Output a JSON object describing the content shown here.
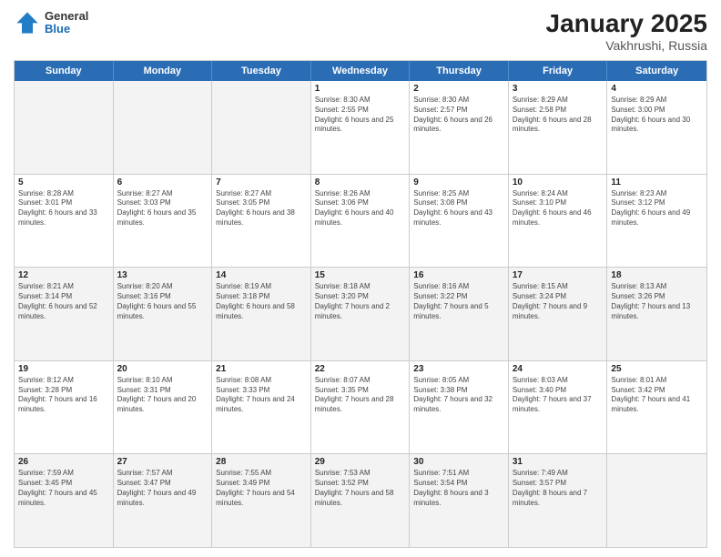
{
  "header": {
    "logo": {
      "general": "General",
      "blue": "Blue"
    },
    "title": "January 2025",
    "location": "Vakhrushi, Russia"
  },
  "weekdays": [
    "Sunday",
    "Monday",
    "Tuesday",
    "Wednesday",
    "Thursday",
    "Friday",
    "Saturday"
  ],
  "weeks": [
    [
      {
        "day": "",
        "sunrise": "",
        "sunset": "",
        "daylight": "",
        "shaded": true
      },
      {
        "day": "",
        "sunrise": "",
        "sunset": "",
        "daylight": "",
        "shaded": true
      },
      {
        "day": "",
        "sunrise": "",
        "sunset": "",
        "daylight": "",
        "shaded": true
      },
      {
        "day": "1",
        "sunrise": "Sunrise: 8:30 AM",
        "sunset": "Sunset: 2:55 PM",
        "daylight": "Daylight: 6 hours and 25 minutes."
      },
      {
        "day": "2",
        "sunrise": "Sunrise: 8:30 AM",
        "sunset": "Sunset: 2:57 PM",
        "daylight": "Daylight: 6 hours and 26 minutes."
      },
      {
        "day": "3",
        "sunrise": "Sunrise: 8:29 AM",
        "sunset": "Sunset: 2:58 PM",
        "daylight": "Daylight: 6 hours and 28 minutes."
      },
      {
        "day": "4",
        "sunrise": "Sunrise: 8:29 AM",
        "sunset": "Sunset: 3:00 PM",
        "daylight": "Daylight: 6 hours and 30 minutes."
      }
    ],
    [
      {
        "day": "5",
        "sunrise": "Sunrise: 8:28 AM",
        "sunset": "Sunset: 3:01 PM",
        "daylight": "Daylight: 6 hours and 33 minutes."
      },
      {
        "day": "6",
        "sunrise": "Sunrise: 8:27 AM",
        "sunset": "Sunset: 3:03 PM",
        "daylight": "Daylight: 6 hours and 35 minutes."
      },
      {
        "day": "7",
        "sunrise": "Sunrise: 8:27 AM",
        "sunset": "Sunset: 3:05 PM",
        "daylight": "Daylight: 6 hours and 38 minutes."
      },
      {
        "day": "8",
        "sunrise": "Sunrise: 8:26 AM",
        "sunset": "Sunset: 3:06 PM",
        "daylight": "Daylight: 6 hours and 40 minutes."
      },
      {
        "day": "9",
        "sunrise": "Sunrise: 8:25 AM",
        "sunset": "Sunset: 3:08 PM",
        "daylight": "Daylight: 6 hours and 43 minutes."
      },
      {
        "day": "10",
        "sunrise": "Sunrise: 8:24 AM",
        "sunset": "Sunset: 3:10 PM",
        "daylight": "Daylight: 6 hours and 46 minutes."
      },
      {
        "day": "11",
        "sunrise": "Sunrise: 8:23 AM",
        "sunset": "Sunset: 3:12 PM",
        "daylight": "Daylight: 6 hours and 49 minutes."
      }
    ],
    [
      {
        "day": "12",
        "sunrise": "Sunrise: 8:21 AM",
        "sunset": "Sunset: 3:14 PM",
        "daylight": "Daylight: 6 hours and 52 minutes.",
        "shaded": true
      },
      {
        "day": "13",
        "sunrise": "Sunrise: 8:20 AM",
        "sunset": "Sunset: 3:16 PM",
        "daylight": "Daylight: 6 hours and 55 minutes.",
        "shaded": true
      },
      {
        "day": "14",
        "sunrise": "Sunrise: 8:19 AM",
        "sunset": "Sunset: 3:18 PM",
        "daylight": "Daylight: 6 hours and 58 minutes.",
        "shaded": true
      },
      {
        "day": "15",
        "sunrise": "Sunrise: 8:18 AM",
        "sunset": "Sunset: 3:20 PM",
        "daylight": "Daylight: 7 hours and 2 minutes.",
        "shaded": true
      },
      {
        "day": "16",
        "sunrise": "Sunrise: 8:16 AM",
        "sunset": "Sunset: 3:22 PM",
        "daylight": "Daylight: 7 hours and 5 minutes.",
        "shaded": true
      },
      {
        "day": "17",
        "sunrise": "Sunrise: 8:15 AM",
        "sunset": "Sunset: 3:24 PM",
        "daylight": "Daylight: 7 hours and 9 minutes.",
        "shaded": true
      },
      {
        "day": "18",
        "sunrise": "Sunrise: 8:13 AM",
        "sunset": "Sunset: 3:26 PM",
        "daylight": "Daylight: 7 hours and 13 minutes.",
        "shaded": true
      }
    ],
    [
      {
        "day": "19",
        "sunrise": "Sunrise: 8:12 AM",
        "sunset": "Sunset: 3:28 PM",
        "daylight": "Daylight: 7 hours and 16 minutes."
      },
      {
        "day": "20",
        "sunrise": "Sunrise: 8:10 AM",
        "sunset": "Sunset: 3:31 PM",
        "daylight": "Daylight: 7 hours and 20 minutes."
      },
      {
        "day": "21",
        "sunrise": "Sunrise: 8:08 AM",
        "sunset": "Sunset: 3:33 PM",
        "daylight": "Daylight: 7 hours and 24 minutes."
      },
      {
        "day": "22",
        "sunrise": "Sunrise: 8:07 AM",
        "sunset": "Sunset: 3:35 PM",
        "daylight": "Daylight: 7 hours and 28 minutes."
      },
      {
        "day": "23",
        "sunrise": "Sunrise: 8:05 AM",
        "sunset": "Sunset: 3:38 PM",
        "daylight": "Daylight: 7 hours and 32 minutes."
      },
      {
        "day": "24",
        "sunrise": "Sunrise: 8:03 AM",
        "sunset": "Sunset: 3:40 PM",
        "daylight": "Daylight: 7 hours and 37 minutes."
      },
      {
        "day": "25",
        "sunrise": "Sunrise: 8:01 AM",
        "sunset": "Sunset: 3:42 PM",
        "daylight": "Daylight: 7 hours and 41 minutes."
      }
    ],
    [
      {
        "day": "26",
        "sunrise": "Sunrise: 7:59 AM",
        "sunset": "Sunset: 3:45 PM",
        "daylight": "Daylight: 7 hours and 45 minutes.",
        "shaded": true
      },
      {
        "day": "27",
        "sunrise": "Sunrise: 7:57 AM",
        "sunset": "Sunset: 3:47 PM",
        "daylight": "Daylight: 7 hours and 49 minutes.",
        "shaded": true
      },
      {
        "day": "28",
        "sunrise": "Sunrise: 7:55 AM",
        "sunset": "Sunset: 3:49 PM",
        "daylight": "Daylight: 7 hours and 54 minutes.",
        "shaded": true
      },
      {
        "day": "29",
        "sunrise": "Sunrise: 7:53 AM",
        "sunset": "Sunset: 3:52 PM",
        "daylight": "Daylight: 7 hours and 58 minutes.",
        "shaded": true
      },
      {
        "day": "30",
        "sunrise": "Sunrise: 7:51 AM",
        "sunset": "Sunset: 3:54 PM",
        "daylight": "Daylight: 8 hours and 3 minutes.",
        "shaded": true
      },
      {
        "day": "31",
        "sunrise": "Sunrise: 7:49 AM",
        "sunset": "Sunset: 3:57 PM",
        "daylight": "Daylight: 8 hours and 7 minutes.",
        "shaded": true
      },
      {
        "day": "",
        "sunrise": "",
        "sunset": "",
        "daylight": "",
        "shaded": true
      }
    ]
  ]
}
